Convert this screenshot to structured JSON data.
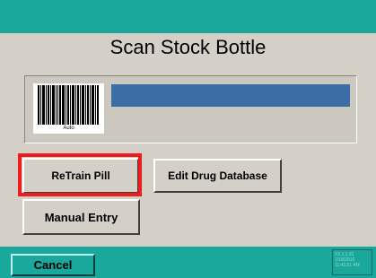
{
  "header": {
    "title": "Scan Stock Bottle"
  },
  "scan": {
    "barcode_mode_label": "Auto",
    "field_value": ""
  },
  "buttons": {
    "retrain_pill": "ReTrain Pill",
    "edit_drug_database": "Edit Drug Database",
    "manual_entry": "Manual Entry",
    "cancel": "Cancel"
  },
  "footer": {
    "version": "V2.1.1.91",
    "date": "1/18/2016",
    "time": "11:43:51 AM"
  },
  "colors": {
    "bar_teal": "#1ba89c",
    "scan_field": "#3a6ea5",
    "highlight": "#ee1c1c",
    "panel": "#d4d0c8"
  }
}
